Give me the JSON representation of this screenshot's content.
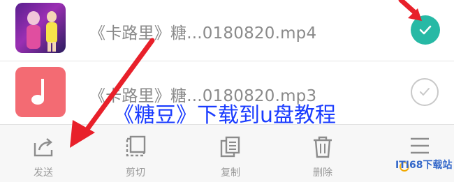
{
  "files": [
    {
      "name": "《卡路里》糖...0180820.mp4",
      "selected": true,
      "thumb_icon": "video-thumbnail"
    },
    {
      "name": "《卡路里》糖...0180820.mp3",
      "selected": false,
      "thumb_icon": "music-note-icon"
    }
  ],
  "overlay_title": "《糖豆》下载到u盘教程",
  "toolbar": {
    "items": [
      {
        "label": "发送",
        "icon": "share-icon"
      },
      {
        "label": "剪切",
        "icon": "cut-icon"
      },
      {
        "label": "复制",
        "icon": "copy-icon"
      },
      {
        "label": "删除",
        "icon": "trash-icon"
      },
      {
        "label": "",
        "icon": "more-menu-icon"
      }
    ]
  },
  "watermark": "ITI68下载站",
  "colors": {
    "check_accent": "#27b9a5",
    "music_thumb": "#f36b73",
    "arrow": "#e8202a",
    "overlay_text": "#1a3cff"
  }
}
